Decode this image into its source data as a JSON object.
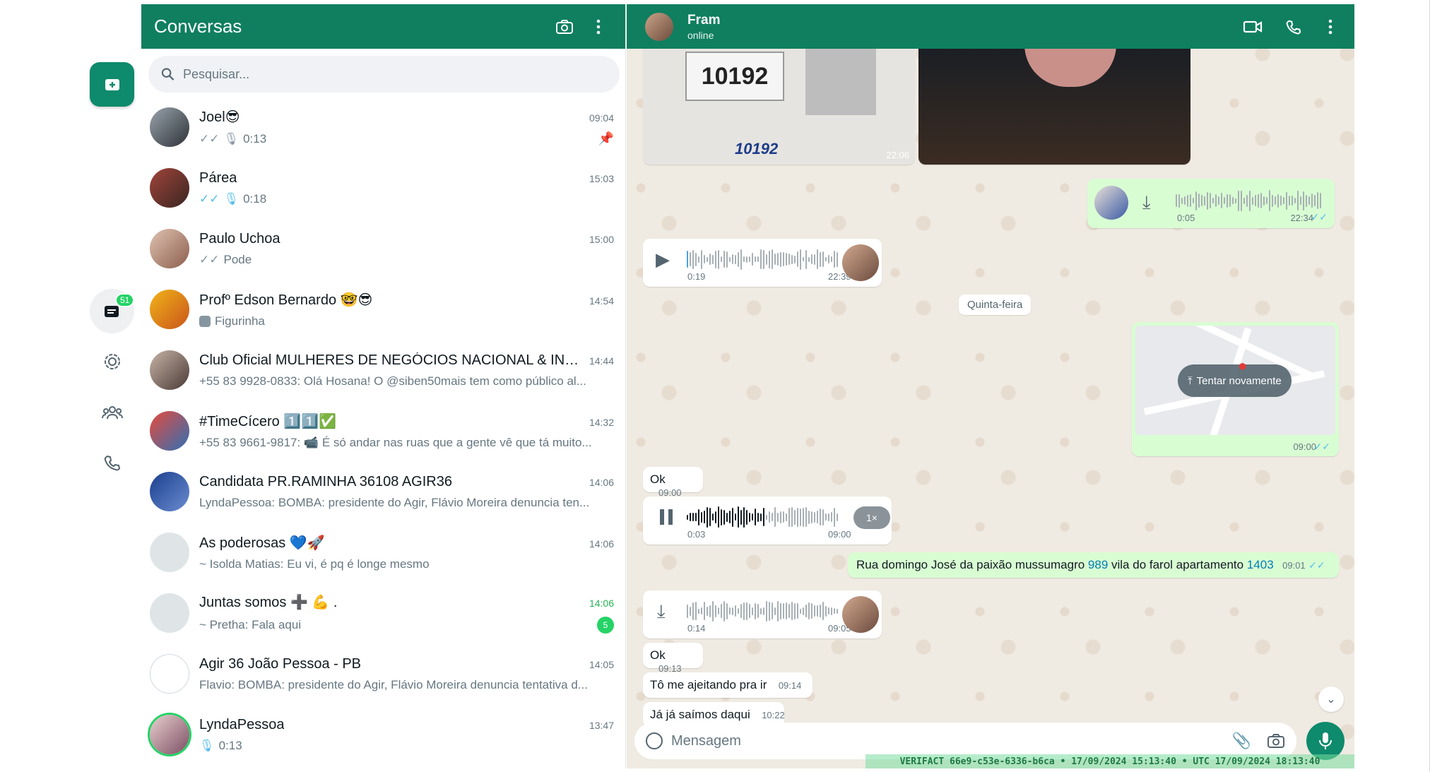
{
  "sidebar": {
    "new_chat_icon": "new-chat-icon",
    "chats_badge": "51"
  },
  "chat_list": {
    "title": "Conversas",
    "search_placeholder": "Pesquisar...",
    "chats": [
      {
        "name": "Joel😎",
        "time": "09:04",
        "preview": "0:13",
        "ticks": "✓✓",
        "mic": true,
        "pinned": true
      },
      {
        "name": "Párea",
        "time": "15:03",
        "preview": "0:18",
        "ticks": "✓✓",
        "mic": true
      },
      {
        "name": "Paulo Uchoa",
        "time": "15:00",
        "preview": "Pode",
        "ticks": "✓✓"
      },
      {
        "name": "Profº Edson Bernardo 🤓😎",
        "time": "14:54",
        "preview": "Figurinha"
      },
      {
        "name": "Club Oficial MULHERES DE NEGÓCIOS NACIONAL & INT...",
        "time": "14:44",
        "preview": "+55 83 9928-0833: Olá Hosana! O @siben50mais tem como público al..."
      },
      {
        "name": "#TimeCícero 1️⃣1️⃣✅",
        "time": "14:32",
        "preview": "+55 83 9661-9817: 📹 É só andar nas ruas que a gente vê que tá muito..."
      },
      {
        "name": "Candidata PR.RAMINHA 36108 AGIR36",
        "time": "14:06",
        "preview": "LyndaPessoa: BOMBA: presidente do Agir, Flávio Moreira denuncia ten..."
      },
      {
        "name": "As poderosas 💙🚀",
        "time": "14:06",
        "preview": "~ Isolda Matias: Eu vi, é pq é longe mesmo"
      },
      {
        "name": "Juntas somos ➕ 💪 .",
        "time": "14:06",
        "preview": "~ Pretha: Fala aqui",
        "unread": "5"
      },
      {
        "name": "Agir 36 João Pessoa - PB",
        "time": "14:05",
        "preview": "Flavio: BOMBA: presidente do Agir, Flávio Moreira denuncia tentativa d..."
      },
      {
        "name": "LyndaPessoa",
        "time": "13:47",
        "preview": "0:13",
        "mic": true
      }
    ]
  },
  "conversation": {
    "contact_name": "Fram",
    "contact_status": "online",
    "image_caption_number": "10192",
    "image_time": "22:06",
    "messages": {
      "audio1": {
        "duration": "0:05",
        "time": "22:34"
      },
      "audio2": {
        "duration": "0:19",
        "time": "22:39"
      },
      "date_chip": "Quinta-feira",
      "location": {
        "retry": "Tentar novamente",
        "time": "09:00"
      },
      "ok1": {
        "text": "Ok",
        "time": "09:00"
      },
      "audio3": {
        "duration": "0:03",
        "time": "09:00",
        "speed": "1×"
      },
      "address": {
        "text_a": "Rua domingo José da paixão mussumagro ",
        "num1": "989",
        "text_b": " vila do farol apartamento ",
        "num2": "1403",
        "time": "09:01"
      },
      "audio4": {
        "duration": "0:14",
        "time": "09:05"
      },
      "ok2": {
        "text": "Ok",
        "time": "09:13"
      },
      "ajeitando": {
        "text": "Tô me ajeitando pra ir",
        "time": "09:14"
      },
      "saimos": {
        "text": "Já já saímos daqui",
        "time": "10:22"
      }
    },
    "composer_placeholder": "Mensagem",
    "watermark": "VERIFACT 66e9-c53e-6336-b6ca • 17/09/2024 15:13:40 • UTC 17/09/2024 18:13:40"
  }
}
